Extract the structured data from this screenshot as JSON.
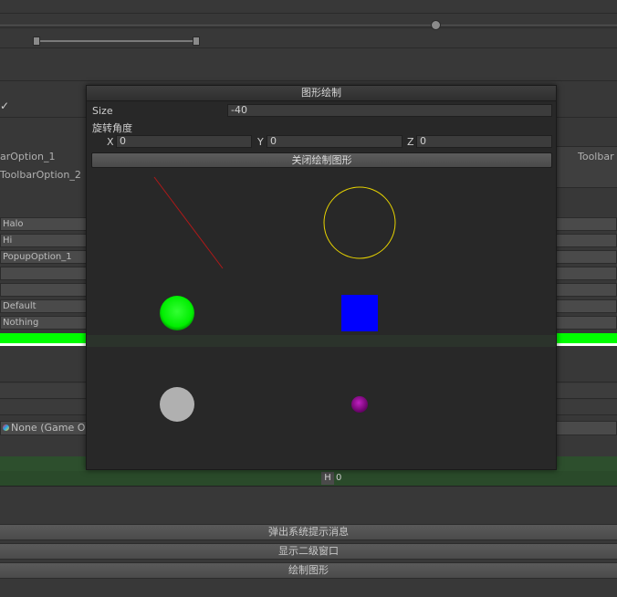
{
  "background": {
    "left_labels": [
      "arOption_1",
      "ToolbarOption_2"
    ],
    "right_label": "Toolbar",
    "fields": [
      "Halo",
      "Hi",
      "PopupOption_1",
      "",
      "",
      "Default",
      "Nothing"
    ],
    "object_field": "None (Game O",
    "h_label": "H",
    "h_value": "0",
    "buttons": [
      "弹出系统提示消息",
      "显示二级窗口",
      "绘制图形"
    ],
    "progress_color": "#00ff00"
  },
  "dialog": {
    "title": "图形绘制",
    "size_label": "Size",
    "size_value": "-40",
    "rotation_label": "旋转角度",
    "x_label": "X",
    "x_value": "0",
    "y_label": "Y",
    "y_value": "0",
    "z_label": "Z",
    "z_value": "0",
    "close_button": "关闭绘制图形"
  },
  "shapes": {
    "line_color": "#b01818",
    "circle_outline_color": "#e6d200",
    "green_disc_color": "#00ff00",
    "blue_square_color": "#0000ff",
    "gray_disc_color": "#b0b0b0",
    "purple_sphere_color": "#a000a0"
  }
}
